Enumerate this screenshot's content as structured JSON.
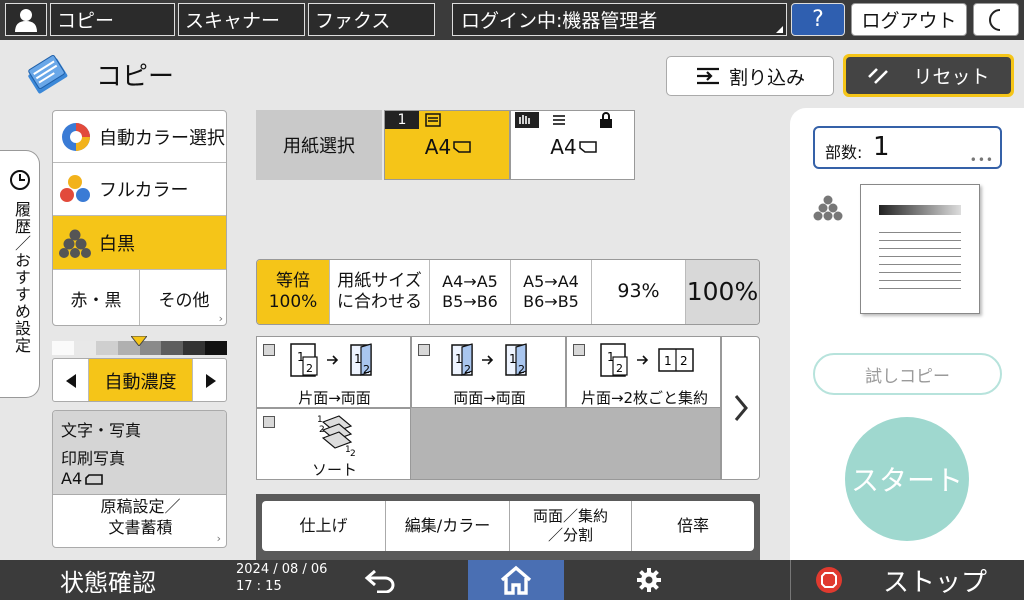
{
  "topbar": {
    "copy_tab": "コピー",
    "scanner_tab": "スキャナー",
    "fax_tab": "ファクス",
    "login_status": "ログイン中:機器管理者",
    "help_label": "?",
    "logout_label": "ログアウト"
  },
  "header": {
    "title": "コピー",
    "interrupt_label": "割り込み",
    "reset_label": "リセット"
  },
  "color_modes": {
    "auto_color": "自動カラー選択",
    "full_color": "フルカラー",
    "black_white": "白黒",
    "red_black": "赤・黒",
    "other": "その他"
  },
  "density": {
    "label": "自動濃度"
  },
  "original": {
    "line1": "文字・写真",
    "line2": "印刷写真",
    "line3": "A4",
    "settings_line1": "原稿設定／",
    "settings_line2": "文書蓄積"
  },
  "paper": {
    "select_label": "用紙選択",
    "tray1_number": "1",
    "tray1_size": "A4",
    "bypass_size": "A4"
  },
  "ratio": {
    "same_line1": "等倍",
    "same_line2": "100%",
    "fit_line1": "用紙サイズ",
    "fit_line2": "に合わせる",
    "a4a5_line1": "A4→A5",
    "a4a5_line2": "B5→B6",
    "a5a4_line1": "A5→A4",
    "a5a4_line2": "B6→B5",
    "pct93": "93%",
    "current": "100%"
  },
  "duplex": {
    "one_to_two": "片面→両面",
    "two_to_two": "両面→両面",
    "combine": "片面→2枚ごと集約",
    "sort": "ソート"
  },
  "bottom_tabs": {
    "finish": "仕上げ",
    "edit": "編集/カラー",
    "duplex_line1": "両面／集約",
    "duplex_line2": "／分割",
    "ratio": "倍率"
  },
  "side_tab": {
    "label": "履歴／おすすめ設定"
  },
  "right_panel": {
    "copies_label": "部数:",
    "copies_value": "1",
    "sample_copy": "試しコピー",
    "start": "スタート"
  },
  "footer": {
    "status_check": "状態確認",
    "date": "2024 / 08 / 06",
    "time": "17 : 15",
    "stop": "ストップ"
  },
  "colors": {
    "accent": "#f5c518",
    "start": "#9fd8cf",
    "topbar": "#3b3b3b",
    "home_button": "#4a6fb3",
    "stop_icon": "#e03a2f"
  }
}
